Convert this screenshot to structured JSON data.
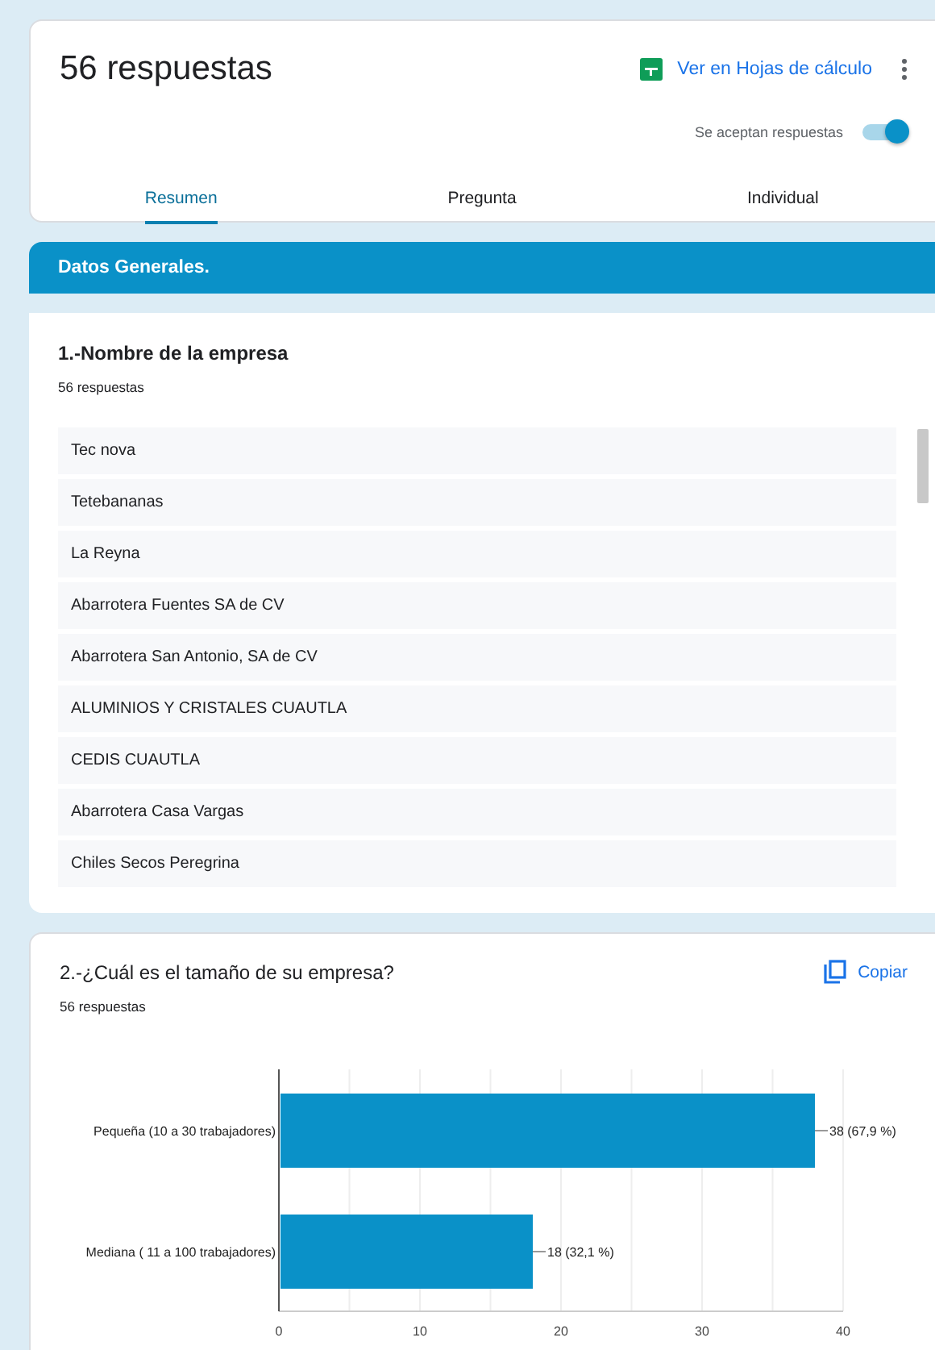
{
  "header": {
    "title": "56 respuestas",
    "sheets_link": "Ver en Hojas de cálculo",
    "accepting": {
      "label": "Se aceptan respuestas",
      "on": true
    }
  },
  "tabs": [
    {
      "label": "Resumen",
      "selected": true
    },
    {
      "label": "Pregunta",
      "selected": false
    },
    {
      "label": "Individual",
      "selected": false
    }
  ],
  "section": {
    "title": "Datos Generales."
  },
  "question_1": {
    "title": "1.-Nombre de la empresa",
    "count": "56 respuestas",
    "answers": [
      "Tec nova",
      "Tetebananas",
      "La Reyna",
      "Abarrotera Fuentes SA de CV",
      "Abarrotera San Antonio, SA de CV",
      "ALUMINIOS Y CRISTALES CUAUTLA",
      "CEDIS CUAUTLA",
      "Abarrotera Casa Vargas",
      "Chiles Secos Peregrina"
    ]
  },
  "question_2": {
    "title": "2.-¿Cuál es el tamaño de su empresa?",
    "count": "56 respuestas",
    "copy": "Copiar",
    "chart_data": {
      "type": "bar",
      "orientation": "horizontal",
      "categories": [
        "Pequeña (10 a 30 trabajadores)",
        "Mediana ( 11 a 100 trabajadores)"
      ],
      "series": [
        {
          "color": "#0a91c8",
          "values": [
            38,
            18
          ]
        }
      ],
      "grid": true,
      "value_labels": [
        "38 (67,9 %)",
        "18 (32,1 %)"
      ],
      "xlim": [
        0,
        40
      ],
      "xticks": [
        0,
        10,
        20,
        30,
        40
      ]
    }
  }
}
